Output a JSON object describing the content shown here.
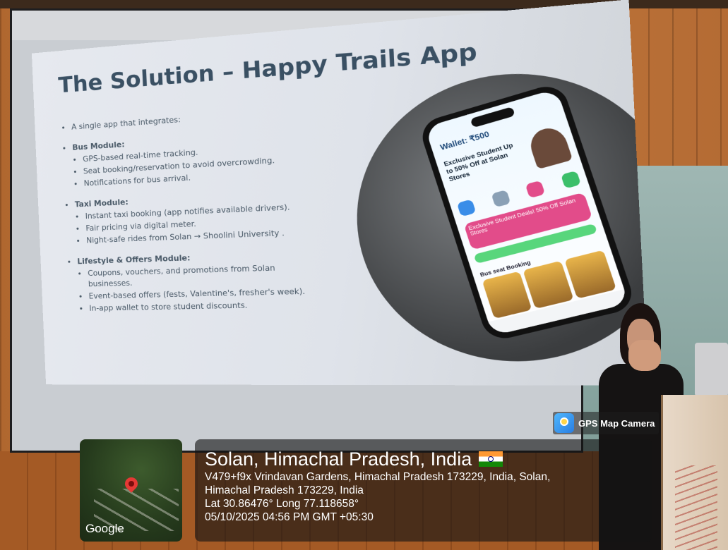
{
  "slide": {
    "title": "The Solution – Happy Trails App",
    "intro": "A single app that integrates:",
    "modules": [
      {
        "name": "Bus Module:",
        "points": [
          "GPS-based real-time tracking.",
          "Seat booking/reservation to avoid overcrowding.",
          "Notifications for bus arrival."
        ]
      },
      {
        "name": "Taxi Module:",
        "points": [
          "Instant taxi booking (app notifies available drivers).",
          "Fair pricing via digital meter.",
          "Night-safe rides from Solan → Shoolini University ."
        ]
      },
      {
        "name": "Lifestyle & Offers Module:",
        "points": [
          "Coupons, vouchers, and promotions from Solan businesses.",
          "Event-based offers (fests, Valentine's, fresher's week).",
          "In-app wallet to store student discounts."
        ]
      }
    ]
  },
  "phone": {
    "wallet": "Wallet: ₹500",
    "promo": "Exclusive Student Up to 50% Off at Solan Stores",
    "deal": "Exclusive Student Deals! 50% Off Solan Stores",
    "bus_section": "Bus seat Booking",
    "icon_colors": [
      "#3a8de8",
      "#8aa0b5",
      "#e24c8a",
      "#3bbf6a"
    ]
  },
  "gps": {
    "badge": "GPS Map Camera",
    "map_label": "Google",
    "location_title": "Solan, Himachal Pradesh, India",
    "address_line1": "V479+f9x Vrindavan Gardens, Himachal Pradesh 173229, India, Solan,",
    "address_line2": "Himachal Pradesh 173229, India",
    "coords": "Lat 30.86476° Long 77.118658°",
    "datetime": "05/10/2025 04:56 PM GMT +05:30"
  }
}
